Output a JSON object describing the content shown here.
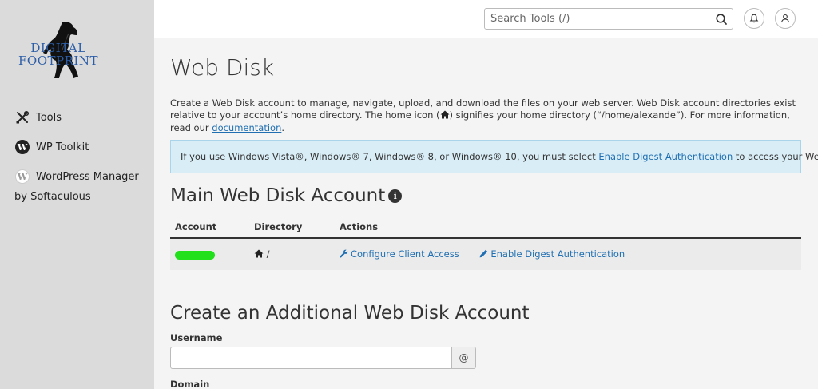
{
  "sidebar": {
    "logo_line1": "DIGITAL",
    "logo_line2": "FOOTPRINT",
    "items": [
      {
        "label": "Tools",
        "icon": "tools-icon"
      },
      {
        "label": "WP Toolkit",
        "icon": "wordpress-icon"
      },
      {
        "label": "WordPress Manager",
        "label2": "by Softaculous",
        "icon": "wordpress-manager-icon"
      }
    ]
  },
  "header": {
    "search_placeholder": "Search Tools (/)"
  },
  "main": {
    "title": "Web Disk",
    "intro_part1": "Create a Web Disk account to manage, navigate, upload, and download the files on your web server. Web Disk account directories exist relative to your account’s home directory. The home icon (",
    "intro_part2": ") signifies your home directory (“/home/alexande”). For more information, read our ",
    "intro_link": "documentation",
    "intro_end": ".",
    "callout_part1": "If you use Windows Vista®, Windows® 7, Windows® 8, or Windows® 10, you must select ",
    "callout_link": "Enable Digest Authentication",
    "callout_part2": " to access your Web Disk.",
    "main_account_heading": "Main Web Disk Account",
    "table": {
      "headers": [
        "Account",
        "Directory",
        "Actions"
      ],
      "row": {
        "directory": "/",
        "action1": "Configure Client Access",
        "action2": "Enable Digest Authentication"
      }
    },
    "create_heading": "Create an Additional Web Disk Account",
    "username_label": "Username",
    "at_symbol": "@",
    "domain_label": "Domain"
  },
  "colors": {
    "accent": "#1f6fb2",
    "callout_bg": "#d9edf7",
    "masked": "#22e01b",
    "sidebar_bg": "#dcdbdb"
  }
}
